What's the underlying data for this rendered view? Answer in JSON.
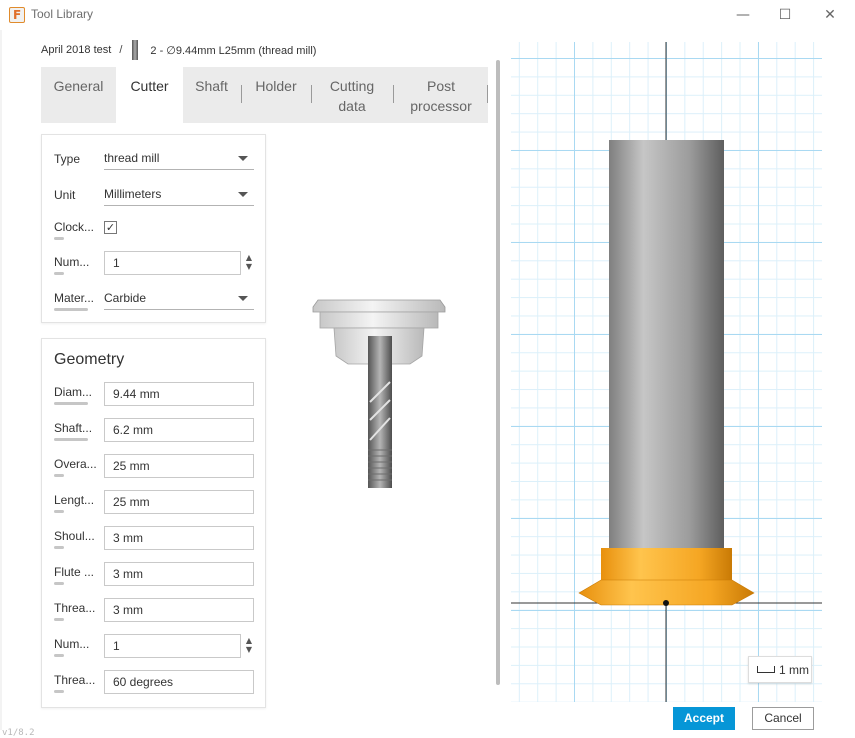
{
  "window": {
    "title": "Tool Library",
    "minimize_icon": "minimize-icon",
    "maximize_icon": "maximize-icon",
    "close_icon": "close-icon"
  },
  "breadcrumb": {
    "library": "April 2018 test",
    "separator": "/",
    "tool": "2 - ∅9.44mm L25mm (thread mill)"
  },
  "tabs": [
    {
      "label": "General"
    },
    {
      "label": "Cutter",
      "active": true
    },
    {
      "label": "Shaft"
    },
    {
      "label": "Holder"
    },
    {
      "label": "Cutting data"
    },
    {
      "label": "Post processor"
    }
  ],
  "cutter": {
    "type_label": "Type",
    "type_value": "thread mill",
    "unit_label": "Unit",
    "unit_value": "Millimeters",
    "clockwise_label": "Clock...",
    "clockwise_checked": "✓",
    "num_label": "Num...",
    "num_value": "1",
    "material_label": "Mater...",
    "material_value": "Carbide"
  },
  "geometry": {
    "title": "Geometry",
    "fields": [
      {
        "label": "Diam...",
        "value": "9.44 mm"
      },
      {
        "label": "Shaft...",
        "value": "6.2 mm"
      },
      {
        "label": "Overa...",
        "value": "25 mm"
      },
      {
        "label": "Lengt...",
        "value": "25 mm"
      },
      {
        "label": "Shoul...",
        "value": "3 mm"
      },
      {
        "label": "Flute ...",
        "value": "3 mm"
      },
      {
        "label": "Threa...",
        "value": "3 mm"
      },
      {
        "label": "Num...",
        "value": "1"
      },
      {
        "label": "Threa...",
        "value": "60 degrees"
      }
    ]
  },
  "viewport": {
    "scale_label": "1 mm",
    "tool_color": "#f5a623",
    "shaft_color": "#9a9a9a",
    "grid_color": "#a9d9f2"
  },
  "footer": {
    "accept_label": "Accept",
    "cancel_label": "Cancel",
    "version": "v1/8.2"
  },
  "colors": {
    "accent": "#0696d7"
  }
}
